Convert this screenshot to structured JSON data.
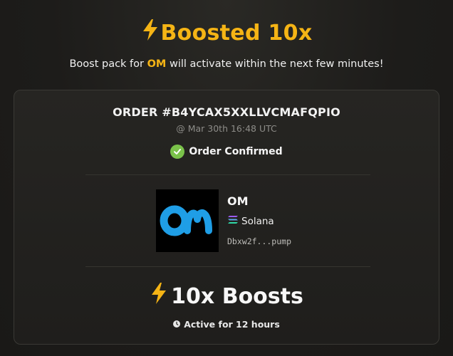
{
  "header": {
    "title": "Boosted 10x",
    "subtitle_prefix": "Boost pack for ",
    "subtitle_token": "OM",
    "subtitle_suffix": " will activate within the next few minutes!"
  },
  "order": {
    "id": "ORDER #B4YCAX5XXLLVCMAFQPIO",
    "time": "@ Mar 30th 16:48 UTC",
    "status": "Order Confirmed"
  },
  "token": {
    "name": "OM",
    "chain": "Solana",
    "address": "Dbxw2f...pump"
  },
  "boost": {
    "label": "10x Boosts",
    "duration": "Active for 12 hours"
  },
  "colors": {
    "accent": "#f5b415",
    "success": "#7ac24a",
    "logo_blue": "#1f9ee6"
  },
  "icons": [
    "lightning-icon",
    "check-circle-icon",
    "solana-icon",
    "clock-icon"
  ]
}
